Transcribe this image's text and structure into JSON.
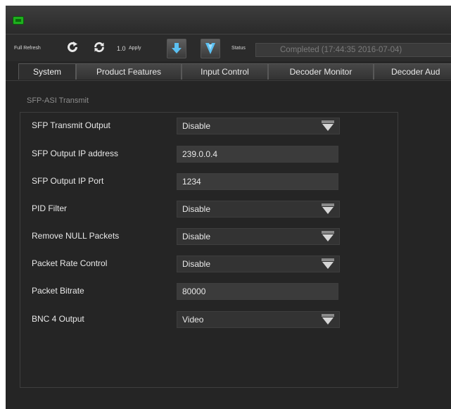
{
  "colors": {
    "background": "#262626",
    "panel": "#333333",
    "accent_blue": "#5bc0f2",
    "icon_green": "#1eb01e"
  },
  "toolbar": {
    "full_refresh_label": "Full Refresh",
    "refresh_icon": "refresh-icon",
    "auto_refresh_icon": "auto-refresh-icon",
    "interval_label": "1.0",
    "apply_label": "Apply",
    "download_icon": "download-arrow-icon",
    "download_all_icon": "download-all-icon",
    "status_label": "Status",
    "status_value": "Completed  (17:44:35  2016-07-04)"
  },
  "tabs": [
    {
      "label": "System"
    },
    {
      "label": "Product Features"
    },
    {
      "label": "Input Control"
    },
    {
      "label": "Decoder Monitor"
    },
    {
      "label": "Decoder Aud"
    }
  ],
  "section": {
    "title": "SFP-ASI Transmit",
    "rows": [
      {
        "label": "SFP Transmit Output",
        "value": "Disable",
        "type": "select"
      },
      {
        "label": "SFP Output IP address",
        "value": "239.0.0.4",
        "type": "text"
      },
      {
        "label": "SFP Output IP Port",
        "value": "1234",
        "type": "text"
      },
      {
        "label": "PID Filter",
        "value": "Disable",
        "type": "select"
      },
      {
        "label": "Remove NULL Packets",
        "value": "Disable",
        "type": "select"
      },
      {
        "label": "Packet Rate Control",
        "value": "Disable",
        "type": "select"
      },
      {
        "label": "Packet Bitrate",
        "value": "80000",
        "type": "text"
      },
      {
        "label": "BNC 4 Output",
        "value": "Video",
        "type": "select"
      }
    ]
  }
}
